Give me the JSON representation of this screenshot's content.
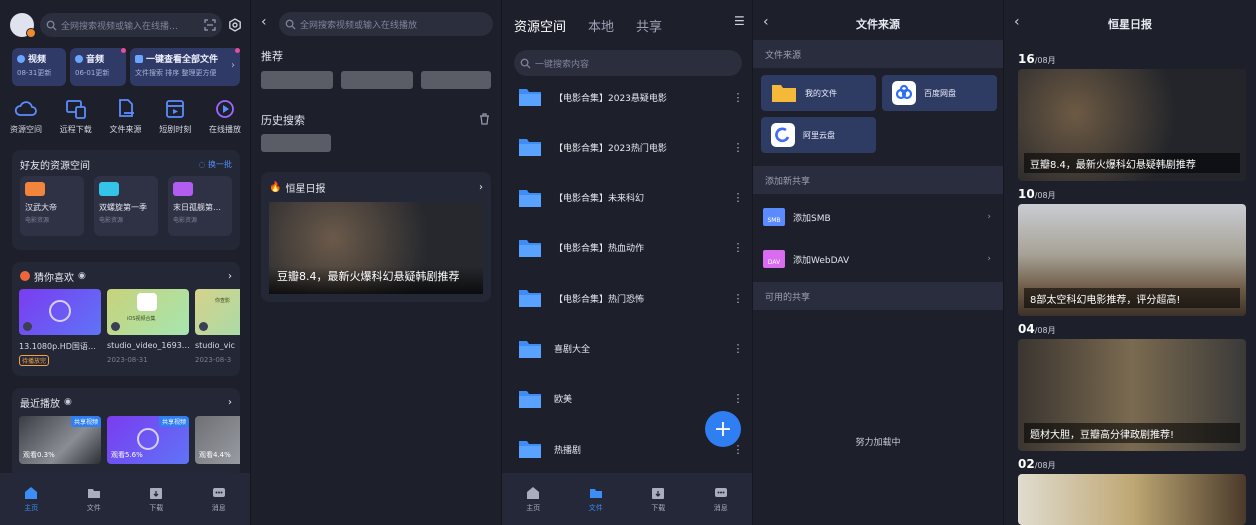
{
  "panel1": {
    "search_placeholder": "全网搜索视频或输入在线播…",
    "quick": [
      {
        "title": "视频",
        "sub": "08-31更新"
      },
      {
        "title": "音频",
        "sub": "06-01更新"
      },
      {
        "title": "一键查看全部文件",
        "sub": "文件搜索 排序 整理更方便"
      }
    ],
    "tools": [
      "资源空间",
      "远程下载",
      "文件来源",
      "短剧时刻",
      "在线播放"
    ],
    "friends": {
      "title": "好友的资源空间",
      "action": "换一批",
      "items": [
        {
          "name": "汉武大帝",
          "sub": "电影资源"
        },
        {
          "name": "双螺旋第一季",
          "sub": "电影资源"
        },
        {
          "name": "末日孤舰第…",
          "sub": "电影资源"
        }
      ]
    },
    "guess": {
      "title": "猜你喜欢",
      "items": [
        {
          "name": "13.1080p.HD国语…",
          "date": "",
          "tag": "待播放完"
        },
        {
          "name": "studio_video_1693…",
          "date": "2023-08-31",
          "thumb_text": "iOS视频合集"
        },
        {
          "name": "studio_vic",
          "date": "2023-08-3",
          "thumb_text": "你查影"
        }
      ]
    },
    "recent": {
      "title": "最近播放",
      "items": [
        {
          "badge": "共享视频",
          "progress": "观看0.3%"
        },
        {
          "badge": "共享视频",
          "progress": "观看5.6%"
        },
        {
          "badge": "",
          "progress": "观看4.4%"
        }
      ]
    },
    "nav": [
      "主页",
      "文件",
      "下载",
      "消息"
    ]
  },
  "panel2": {
    "search_placeholder": "全网搜索视频或输入在线播放",
    "recommend_title": "推荐",
    "history_title": "历史搜索",
    "daily_title": "恒星日报",
    "daily_caption": "豆瓣8.4，最新火爆科幻悬疑韩剧推荐"
  },
  "panel3": {
    "tabs": [
      "资源空间",
      "本地",
      "共享"
    ],
    "search_placeholder": "一键搜索内容",
    "folders": [
      "【电影合集】2023悬疑电影",
      "【电影合集】2023热门电影",
      "【电影合集】未来科幻",
      "【电影合集】热血动作",
      "【电影合集】热门恐怖",
      "喜剧大全",
      "欧美",
      "热播剧"
    ],
    "fab": "+",
    "nav": [
      "主页",
      "文件",
      "下载",
      "消息"
    ]
  },
  "panel4": {
    "title": "文件来源",
    "group_source": "文件来源",
    "sources": [
      "我的文件",
      "百度网盘",
      "阿里云盘"
    ],
    "group_add": "添加新共享",
    "adds": [
      {
        "label": "添加SMB",
        "icon": "SMB"
      },
      {
        "label": "添加WebDAV",
        "icon": "DAV"
      }
    ],
    "group_avail": "可用的共享",
    "loading": "努力加载中"
  },
  "panel5": {
    "title": "恒星日报",
    "days": [
      {
        "day": "16",
        "month": "/08月",
        "caption": "豆瓣8.4，最新火爆科幻悬疑韩剧推荐"
      },
      {
        "day": "10",
        "month": "/08月",
        "caption": "8部太空科幻电影推荐，评分超高!"
      },
      {
        "day": "04",
        "month": "/08月",
        "caption": "题材大胆，豆瓣高分律政剧推荐!"
      },
      {
        "day": "02",
        "month": "/08月",
        "caption": ""
      }
    ]
  },
  "colors": {
    "accent": "#2f7ff3",
    "card": "#242736",
    "bg": "#1d1f2b"
  }
}
